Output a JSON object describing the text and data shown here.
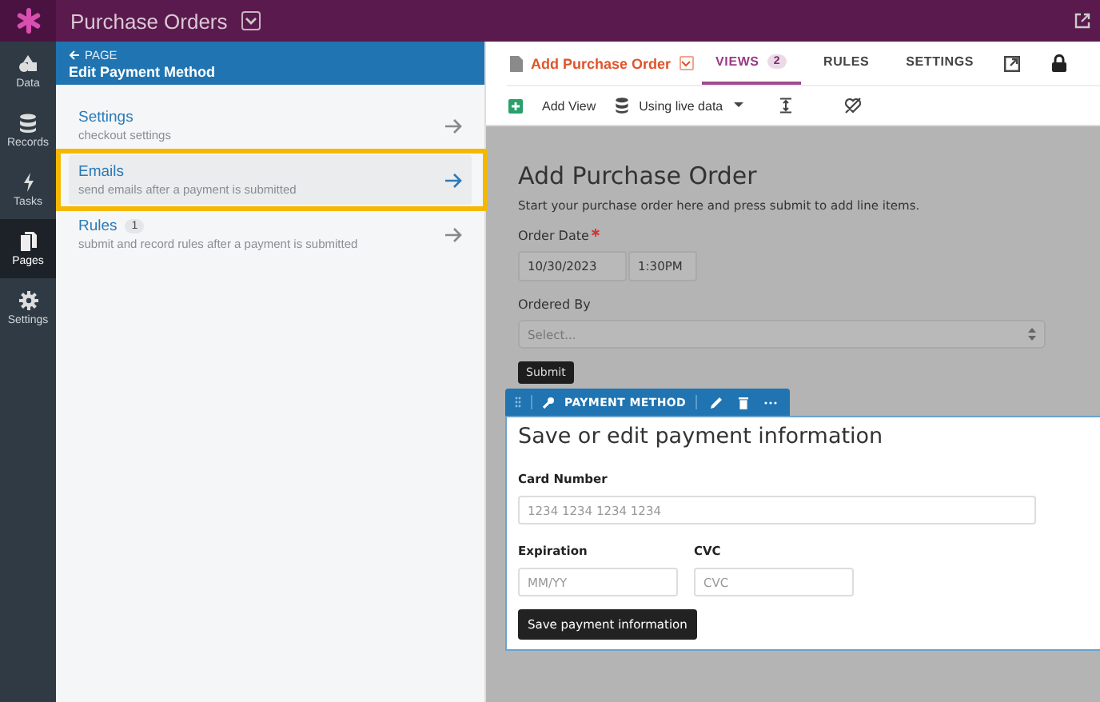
{
  "app": {
    "title": "Purchase Orders"
  },
  "nav": [
    {
      "label": "Data",
      "selected": false
    },
    {
      "label": "Records",
      "selected": false
    },
    {
      "label": "Tasks",
      "selected": false
    },
    {
      "label": "Pages",
      "selected": true
    },
    {
      "label": "Settings",
      "selected": false
    }
  ],
  "panel": {
    "back": "PAGE",
    "title": "Edit Payment Method",
    "items": [
      {
        "title": "Settings",
        "subtitle": "checkout settings",
        "selected": false,
        "highlighted": false
      },
      {
        "title": "Emails",
        "subtitle": "send emails after a payment is submitted",
        "selected": true,
        "highlighted": true
      },
      {
        "title": "Rules",
        "badge": "1",
        "subtitle": "submit and record rules after a payment is submitted",
        "selected": false,
        "highlighted": false
      }
    ]
  },
  "page": {
    "title": "Add Purchase Order",
    "tabs": [
      {
        "label": "VIEWS",
        "count": "2",
        "selected": true
      },
      {
        "label": "RULES",
        "selected": false
      },
      {
        "label": "SETTINGS",
        "selected": false
      }
    ],
    "add_view": "Add View",
    "data_source": "Using live data"
  },
  "form": {
    "title": "Add Purchase Order",
    "description": "Start your purchase order here and press submit to add line items.",
    "fields": [
      {
        "kind": "datetime",
        "label": "Order Date",
        "required": true,
        "date": "10/30/2023",
        "time": "1:30PM"
      },
      {
        "kind": "select",
        "label": "Ordered By",
        "required": false,
        "placeholder": "Select..."
      }
    ],
    "submit": "Submit"
  },
  "payment": {
    "view_label": "PAYMENT METHOD",
    "title": "Save or edit payment information",
    "rows": [
      [
        {
          "label": "Card Number",
          "placeholder": "1234 1234 1234 1234",
          "kind": "wide"
        }
      ],
      [
        {
          "label": "Expiration",
          "placeholder": "MM/YY",
          "kind": "short"
        },
        {
          "label": "CVC",
          "placeholder": "CVC",
          "kind": "short"
        }
      ]
    ],
    "button": "Save payment information"
  }
}
